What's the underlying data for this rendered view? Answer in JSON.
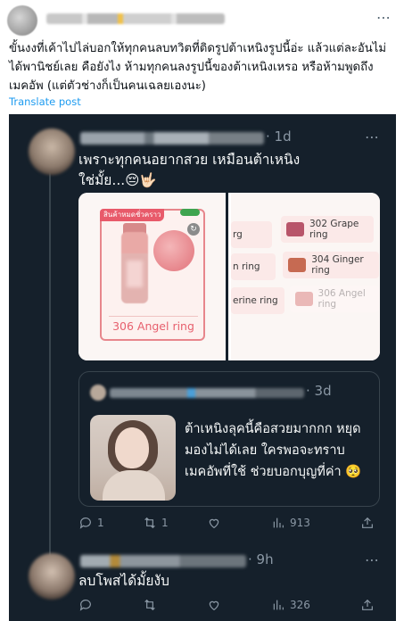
{
  "outer_post": {
    "text": "ขั้นงงที่เค้าไปไล่บอกให้ทุกคนลบทวิตที่ติดรูปต้าเหนิงรูปนี้อ่ะ แล้วแต่ละอันไม่ได้พานิชย์เลย คือยังไง ห้ามทุกคนลงรูปนี้ของต้าเหนิงเหรอ หรือห้ามพูดถึงเมคอัพ (แต่ตัวช่างก็เป็นคนเฉลยเองนะ)",
    "translate_label": "Translate post",
    "more_icon": "⋯"
  },
  "reply": {
    "time": "· 1d",
    "text": "เพราะทุกคนอยากสวย เหมือนต้าเหนิง ใช่มั้ย...😔🤟🏻",
    "more_icon": "⋯",
    "media": {
      "card_banner": "สินค้าหมดชั่วคราว",
      "card_product": "306 Angel ring",
      "chips": [
        {
          "label": "rg",
          "color": "#c9857c",
          "faded": false
        },
        {
          "label": "302 Grape ring",
          "color": "#b8556a",
          "faded": false
        },
        {
          "label": "n ring",
          "color": "#d08a7a",
          "faded": false
        },
        {
          "label": "304 Ginger ring",
          "color": "#c66a52",
          "faded": false
        },
        {
          "label": "erine ring",
          "color": "#e7b3ae",
          "faded": false
        },
        {
          "label": "306 Angel ring",
          "color": "#eab8b7",
          "faded": true
        }
      ]
    },
    "quote": {
      "time": "· 3d",
      "text": "ต้าเหนิงลุคนี้คือสวยมากกก หยุดมองไม่ได้เลย ใครพอจะทราบเมคอัพที่ใช้ ช่วยบอกบุญที่ค่า 🥺"
    },
    "actions": {
      "replies": "1",
      "reposts": "1",
      "views": "913"
    }
  },
  "reply2": {
    "time": "· 9h",
    "text": "ลบโพสได้มั้ยงับ",
    "more_icon": "⋯",
    "actions": {
      "replies": "",
      "reposts": "",
      "views": "326"
    }
  }
}
